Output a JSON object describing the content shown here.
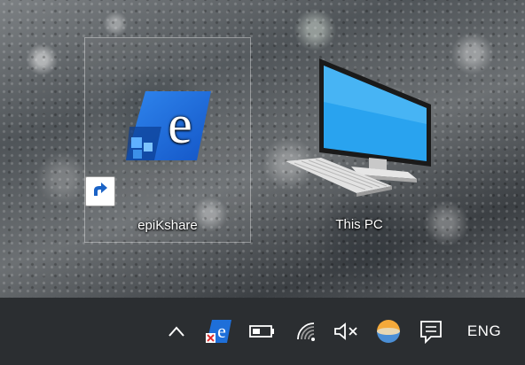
{
  "desktop": {
    "icons": [
      {
        "label": "epiKshare",
        "icon": "epikshare-app-icon",
        "shortcut": true,
        "selected": true
      },
      {
        "label": "This PC",
        "icon": "computer-monitor-icon",
        "shortcut": false,
        "selected": false
      }
    ]
  },
  "taskbar": {
    "tray": [
      {
        "icon": "chevron-up-icon",
        "meaning": "show-hidden-icons"
      },
      {
        "icon": "epikshare-tray-icon"
      },
      {
        "icon": "battery-icon"
      },
      {
        "icon": "wifi-no-internet-icon"
      },
      {
        "icon": "speaker-muted-icon"
      },
      {
        "icon": "weather-icon"
      },
      {
        "icon": "action-center-icon"
      }
    ],
    "language": "ENG"
  },
  "colors": {
    "taskbar": "#2b2e31",
    "epik_blue": "#1e6fd9",
    "epik_dark_blue": "#0b3d91",
    "epik_light_blue": "#5fb0ff",
    "monitor_screen": "#29a3ef"
  }
}
